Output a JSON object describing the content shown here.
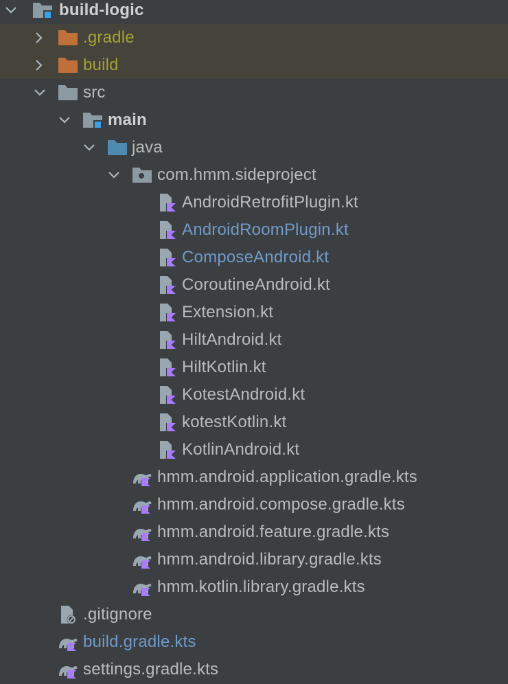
{
  "colors": {
    "background": "#3c3f41",
    "excluded_row_bg": "#45433a",
    "default_text": "#bbbbbb",
    "excluded_text": "#a3a332",
    "modified_text": "#6f9ac9",
    "kotlin_accent": "#a97bff",
    "folder_grey": "#8c9aa2",
    "folder_blue": "#4f8bb1",
    "folder_orange": "#c0713a"
  },
  "tree": {
    "rows": [
      {
        "label": "build-logic",
        "icon": "module-folder-icon",
        "expanded": true,
        "style": "bold"
      },
      {
        "label": ".gradle",
        "icon": "excluded-folder-icon",
        "expanded": false,
        "style": "excluded"
      },
      {
        "label": "build",
        "icon": "excluded-folder-icon",
        "expanded": false,
        "style": "excluded"
      },
      {
        "label": "src",
        "icon": "folder-icon",
        "expanded": true,
        "style": "normal"
      },
      {
        "label": "main",
        "icon": "module-folder-icon",
        "expanded": true,
        "style": "bold"
      },
      {
        "label": "java",
        "icon": "source-folder-icon",
        "expanded": true,
        "style": "normal"
      },
      {
        "label": "com.hmm.sideproject",
        "icon": "package-icon",
        "expanded": true,
        "style": "normal"
      },
      {
        "label": "AndroidRetrofitPlugin.kt",
        "icon": "kotlin-file-icon",
        "style": "normal"
      },
      {
        "label": "AndroidRoomPlugin.kt",
        "icon": "kotlin-file-icon",
        "style": "modified"
      },
      {
        "label": "ComposeAndroid.kt",
        "icon": "kotlin-file-icon",
        "style": "modified"
      },
      {
        "label": "CoroutineAndroid.kt",
        "icon": "kotlin-file-icon",
        "style": "normal"
      },
      {
        "label": "Extension.kt",
        "icon": "kotlin-file-icon",
        "style": "normal"
      },
      {
        "label": "HiltAndroid.kt",
        "icon": "kotlin-file-icon",
        "style": "normal"
      },
      {
        "label": "HiltKotlin.kt",
        "icon": "kotlin-file-icon",
        "style": "normal"
      },
      {
        "label": "KotestAndroid.kt",
        "icon": "kotlin-file-icon",
        "style": "normal"
      },
      {
        "label": "kotestKotlin.kt",
        "icon": "kotlin-file-icon",
        "style": "normal"
      },
      {
        "label": "KotlinAndroid.kt",
        "icon": "kotlin-file-icon",
        "style": "normal"
      },
      {
        "label": "hmm.android.application.gradle.kts",
        "icon": "gradle-kts-icon",
        "style": "normal"
      },
      {
        "label": "hmm.android.compose.gradle.kts",
        "icon": "gradle-kts-icon",
        "style": "normal"
      },
      {
        "label": "hmm.android.feature.gradle.kts",
        "icon": "gradle-kts-icon",
        "style": "normal"
      },
      {
        "label": "hmm.android.library.gradle.kts",
        "icon": "gradle-kts-icon",
        "style": "normal"
      },
      {
        "label": "hmm.kotlin.library.gradle.kts",
        "icon": "gradle-kts-icon",
        "style": "normal"
      },
      {
        "label": ".gitignore",
        "icon": "ignore-file-icon",
        "style": "normal"
      },
      {
        "label": "build.gradle.kts",
        "icon": "gradle-kts-icon",
        "style": "modified"
      },
      {
        "label": "settings.gradle.kts",
        "icon": "gradle-kts-icon",
        "style": "normal"
      }
    ]
  }
}
